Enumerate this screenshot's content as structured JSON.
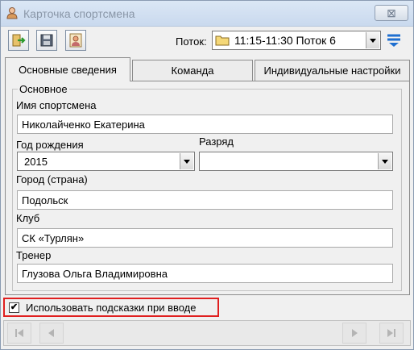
{
  "window": {
    "title": "Карточка спортсмена",
    "close_glyph": "⊠"
  },
  "toolbar": {
    "stream_label": "Поток:",
    "stream_value": "11:15-11:30 Поток 6"
  },
  "tabs": [
    {
      "label": "Основные сведения",
      "active": true
    },
    {
      "label": "Команда",
      "active": false
    },
    {
      "label": "Индивидуальные настройки",
      "active": false
    }
  ],
  "group": {
    "title": "Основное",
    "name_label": "Имя спортсмена",
    "name_value": "Николайченко Екатерина",
    "birth_year_label": "Год рождения",
    "birth_year_value": "2015",
    "rank_label": "Разряд",
    "rank_value": "",
    "city_label": "Город (страна)",
    "city_value": "Подольск",
    "club_label": "Клуб",
    "club_value": "СК «Турлян»",
    "coach_label": "Тренер",
    "coach_value": "Глузова Ольга Владимировна"
  },
  "hints": {
    "label": "Использовать подсказки при вводе",
    "checked": true,
    "check_glyph": "✔"
  },
  "colors": {
    "highlight": "#e01f1f",
    "accent": "#1f6fd0"
  },
  "icons": [
    "user-icon",
    "exit-icon",
    "save-icon",
    "person-card-icon",
    "folder-icon",
    "filter-icon",
    "first-record-icon",
    "prev-record-icon",
    "next-record-icon",
    "last-record-icon"
  ]
}
